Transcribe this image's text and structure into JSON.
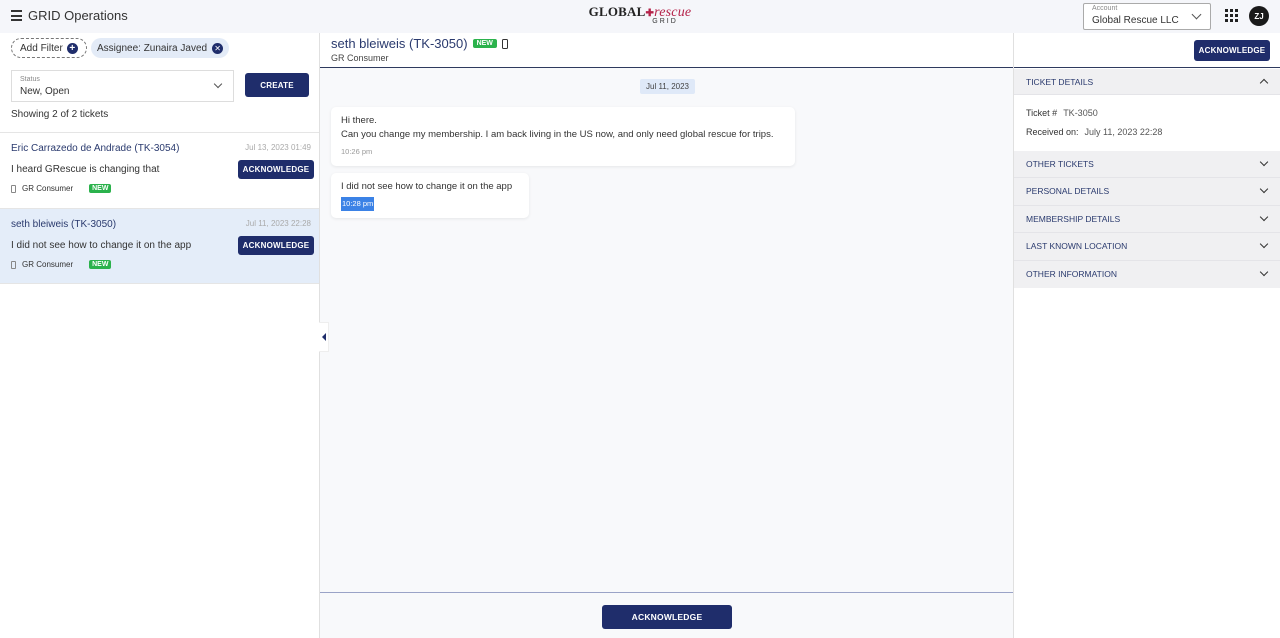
{
  "topbar": {
    "app_title": "GRID Operations",
    "logo_global": "GLOBAL",
    "logo_rescue": "rescue",
    "logo_grid": "GRID",
    "account_label": "Account",
    "account_value": "Global Rescue LLC",
    "avatar_initials": "ZJ"
  },
  "filters": {
    "add_filter_label": "Add Filter",
    "assignee_chip": "Assignee: Zunaira Javed",
    "status_label": "Status",
    "status_value": "New, Open",
    "create_label": "CREATE",
    "showing_text": "Showing 2 of 2 tickets"
  },
  "tickets": [
    {
      "name": "Eric Carrazedo de Andrade (TK-3054)",
      "date": "Jul 13, 2023 01:49",
      "message": "I heard GRescue is changing that",
      "source": "GR Consumer",
      "badge": "NEW",
      "ack_label": "ACKNOWLEDGE",
      "selected": false
    },
    {
      "name": "seth bleiweis (TK-3050)",
      "date": "Jul 11, 2023 22:28",
      "message": "I did not see how to change it on the app",
      "source": "GR Consumer",
      "badge": "NEW",
      "ack_label": "ACKNOWLEDGE",
      "selected": true
    }
  ],
  "chat": {
    "title": "seth bleiweis (TK-3050)",
    "badge": "NEW",
    "subtitle": "GR Consumer",
    "date_divider": "Jul 11, 2023",
    "messages": [
      {
        "line1": "Hi there.",
        "line2": "Can you change my membership. I am back living in the US now, and only need global rescue for trips.",
        "time": "10:26 pm"
      },
      {
        "line1": "I did not see how to change it on the app",
        "time": "10:28 pm",
        "time_highlighted": true
      }
    ],
    "footer_ack_label": "ACKNOWLEDGE"
  },
  "details": {
    "ack_label": "ACKNOWLEDGE",
    "ticket_details_header": "TICKET DETAILS",
    "ticket_label": "Ticket #",
    "ticket_value": "TK-3050",
    "received_label": "Received on:",
    "received_value": "July 11, 2023 22:28",
    "sections": [
      "OTHER TICKETS",
      "PERSONAL DETAILS",
      "MEMBERSHIP DETAILS",
      "LAST KNOWN LOCATION",
      "OTHER INFORMATION"
    ]
  },
  "colors": {
    "primary": "#1f2d6b",
    "new_badge": "#2bb24c",
    "selected_row": "#e4edf9",
    "logo_accent": "#b5234a"
  }
}
